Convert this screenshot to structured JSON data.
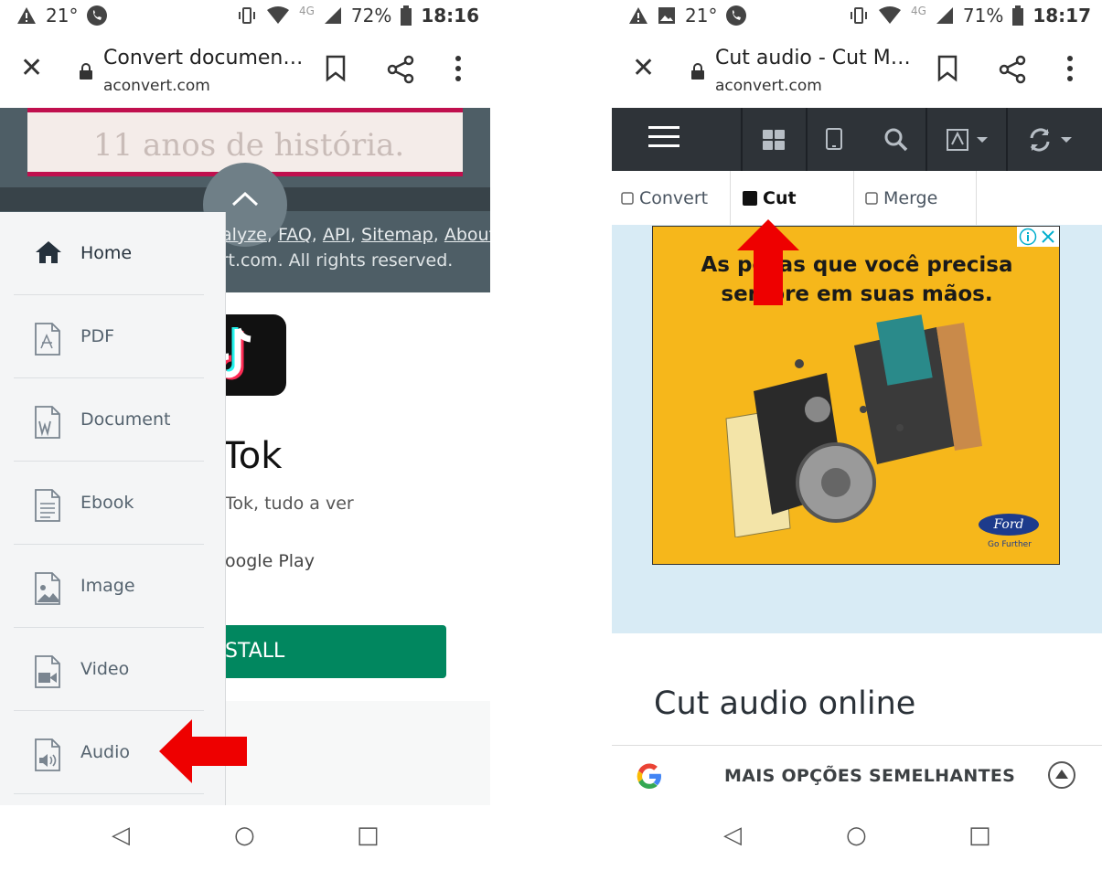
{
  "left": {
    "status": {
      "temp": "21°",
      "battery": "72%",
      "time": "18:16",
      "network": "4G"
    },
    "toolbar": {
      "title": "Convert documen…",
      "domain": "aconvert.com"
    },
    "page": {
      "banner": "11 anos de história.",
      "footer_links": [
        "nalyze",
        "FAQ",
        "API",
        "Sitemap",
        "About"
      ],
      "copyright": "ert.com. All rights reserved.",
      "app_name": "kTok",
      "app_desc": "Tok, tudo a ver",
      "store": "oogle Play",
      "install": "STALL"
    },
    "drawer": {
      "items": [
        {
          "label": "Home",
          "icon": "home-icon"
        },
        {
          "label": "PDF",
          "icon": "pdf-file-icon"
        },
        {
          "label": "Document",
          "icon": "word-file-icon"
        },
        {
          "label": "Ebook",
          "icon": "ebook-file-icon"
        },
        {
          "label": "Image",
          "icon": "image-file-icon"
        },
        {
          "label": "Video",
          "icon": "video-file-icon"
        },
        {
          "label": "Audio",
          "icon": "audio-file-icon"
        }
      ]
    }
  },
  "right": {
    "status": {
      "temp": "21°",
      "battery": "71%",
      "time": "18:17",
      "network": "4G"
    },
    "toolbar": {
      "title": "Cut audio - Cut M…",
      "domain": "aconvert.com"
    },
    "tabs": [
      {
        "label": "Convert",
        "checked": false
      },
      {
        "label": "Cut",
        "checked": true
      },
      {
        "label": "Merge",
        "checked": false
      }
    ],
    "ad": {
      "line1": "As peças que você precisa",
      "line2": "sempre em suas mãos.",
      "brand": "Ford",
      "tagline": "Go Further"
    },
    "heading": "Cut audio online",
    "suggest": "MAIS OPÇÕES SEMELHANTES"
  },
  "colors": {
    "arrow": "#ee0000",
    "install": "#01875f",
    "header": "#2e3338"
  }
}
